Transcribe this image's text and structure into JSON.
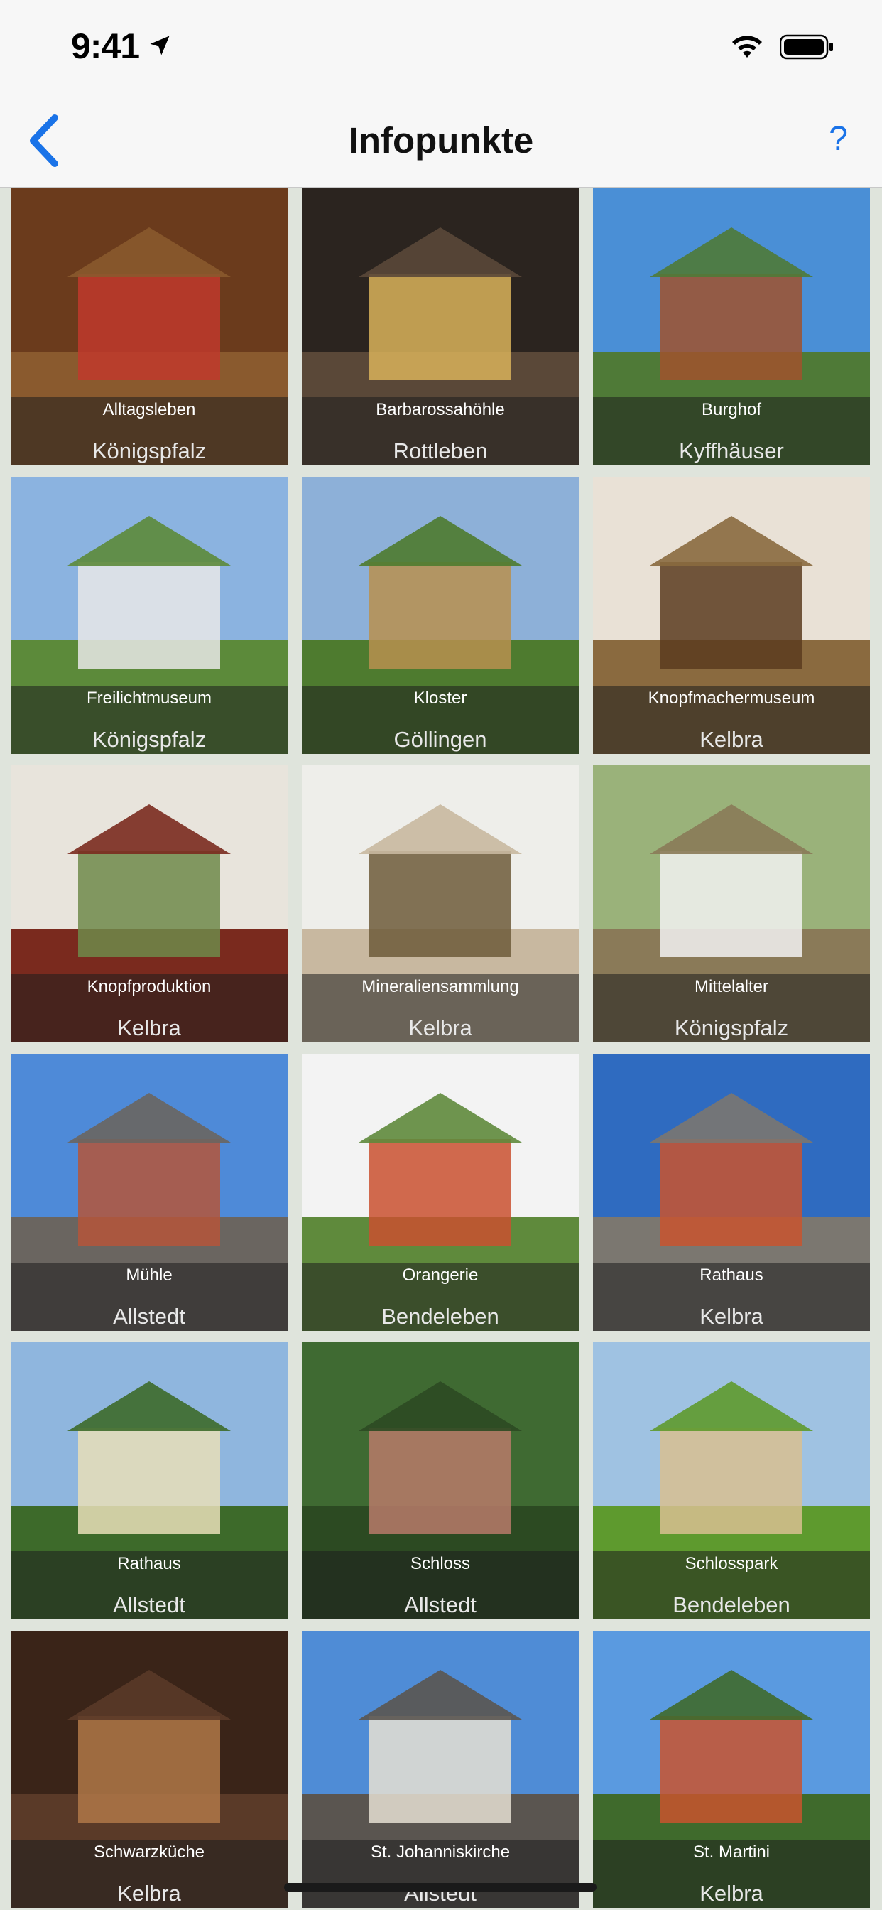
{
  "status": {
    "time": "9:41"
  },
  "nav": {
    "title": "Infopunkte",
    "help": "?"
  },
  "tiles": [
    {
      "title": "Alltagsleben",
      "subtitle": "Königspfalz",
      "sky": "#6b3b1c",
      "ground": "#8a5a2e",
      "accent": "#c0392b"
    },
    {
      "title": "Barbarossahöhle",
      "subtitle": "Rottleben",
      "sky": "#2b241f",
      "ground": "#5a4838",
      "accent": "#d9b35a"
    },
    {
      "title": "Burghof",
      "subtitle": "Kyffhäuser",
      "sky": "#4a8fd6",
      "ground": "#4f7a37",
      "accent": "#a0522d"
    },
    {
      "title": "Freilichtmuseum",
      "subtitle": "Königspfalz",
      "sky": "#8bb3e0",
      "ground": "#5c8a3a",
      "accent": "#e8e8e8"
    },
    {
      "title": "Kloster",
      "subtitle": "Göllingen",
      "sky": "#8db0d8",
      "ground": "#4e7b2f",
      "accent": "#b9904f"
    },
    {
      "title": "Knopfmachermuseum",
      "subtitle": "Kelbra",
      "sky": "#e9e1d6",
      "ground": "#8a6a3f",
      "accent": "#5a3b1e"
    },
    {
      "title": "Knopfproduktion",
      "subtitle": "Kelbra",
      "sky": "#e8e4dc",
      "ground": "#7a2a1e",
      "accent": "#6f8a4a"
    },
    {
      "title": "Mineraliensammlung",
      "subtitle": "Kelbra",
      "sky": "#eeeeea",
      "ground": "#c8b8a0",
      "accent": "#6d5a3a"
    },
    {
      "title": "Mittelalter",
      "subtitle": "Königspfalz",
      "sky": "#9ab27a",
      "ground": "#8a7a58",
      "accent": "#f2f2f2"
    },
    {
      "title": "Mühle",
      "subtitle": "Allstedt",
      "sky": "#4e8ad8",
      "ground": "#6a6560",
      "accent": "#b5553a"
    },
    {
      "title": "Orangerie",
      "subtitle": "Bendeleben",
      "sky": "#f3f3f3",
      "ground": "#5f8a3c",
      "accent": "#c9502f"
    },
    {
      "title": "Rathaus",
      "subtitle": "Kelbra",
      "sky": "#2f6bc0",
      "ground": "#7b7770",
      "accent": "#c9542e"
    },
    {
      "title": "Rathaus",
      "subtitle": "Allstedt",
      "sky": "#8fb6de",
      "ground": "#3d6a2a",
      "accent": "#e9dfb8"
    },
    {
      "title": "Schloss",
      "subtitle": "Allstedt",
      "sky": "#3f6a32",
      "ground": "#2c4a22",
      "accent": "#b97a6a"
    },
    {
      "title": "Schlosspark",
      "subtitle": "Bendeleben",
      "sky": "#9fc2e2",
      "ground": "#5e9a2e",
      "accent": "#d8c090"
    },
    {
      "title": "Schwarzküche",
      "subtitle": "Kelbra",
      "sky": "#3a2418",
      "ground": "#5a3a28",
      "accent": "#b07848"
    },
    {
      "title": "St. Johanniskirche",
      "subtitle": "Allstedt",
      "sky": "#4f8cd6",
      "ground": "#5a5550",
      "accent": "#e6e0d2"
    },
    {
      "title": "St. Martini",
      "subtitle": "Kelbra",
      "sky": "#5a9ae0",
      "ground": "#3f6a2c",
      "accent": "#c9542e"
    }
  ]
}
